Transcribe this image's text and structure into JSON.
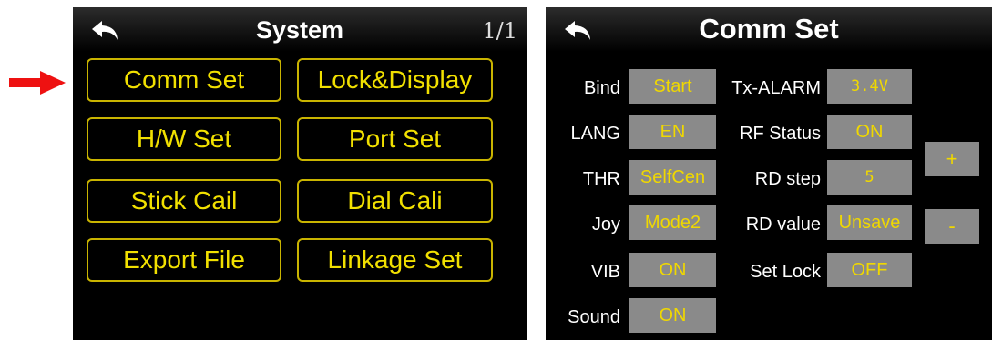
{
  "system": {
    "title": "System",
    "page": "1/1",
    "buttons": [
      "Comm Set",
      "Lock&Display",
      "H/W Set",
      "Port Set",
      "Stick Cail",
      "Dial Cali",
      "Export File",
      "Linkage Set"
    ]
  },
  "comm": {
    "title": "Comm Set",
    "left_labels": [
      "Bind",
      "LANG",
      "THR",
      "Joy",
      "VIB",
      "Sound"
    ],
    "left_values": [
      "Start",
      "EN",
      "SelfCen",
      "Mode2",
      "ON",
      "ON"
    ],
    "right_labels": [
      "Tx-ALARM",
      "RF Status",
      "RD step",
      "RD value",
      "Set Lock"
    ],
    "right_values": [
      "3.4V",
      "ON",
      "5",
      "Unsave",
      "OFF"
    ],
    "plus": "+",
    "minus": "-"
  },
  "colors": {
    "accent_red": "#ee1111",
    "button_border": "#c9b400",
    "button_text": "#f1e000",
    "value_bg": "#8a8a8a"
  }
}
